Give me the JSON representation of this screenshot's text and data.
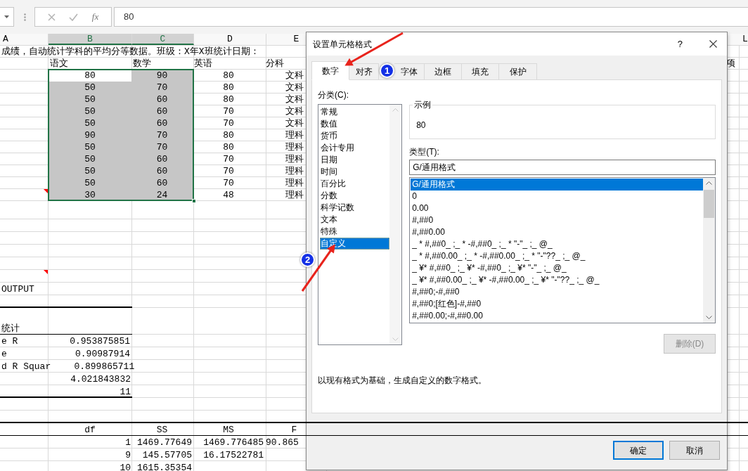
{
  "formula_bar": {
    "function_label": "fx",
    "value": "80"
  },
  "sheet": {
    "columns": [
      {
        "label": "A",
        "selected": false
      },
      {
        "label": "B",
        "selected": true
      },
      {
        "label": "C",
        "selected": true
      },
      {
        "label": "D",
        "selected": false
      },
      {
        "label": "E",
        "selected": false
      },
      {
        "label": "L",
        "selected": false
      }
    ],
    "rows": [
      {
        "cells": {
          "a": {
            "text": "成绩，自动统计学科的平均分等数据。班级：X年X班统计日期："
          }
        }
      },
      {
        "cells": {
          "b": {
            "text": "语文"
          },
          "c": {
            "text": "数学"
          },
          "d": {
            "text": "英语"
          },
          "e": {
            "text": "分科"
          },
          "k": {
            "text": "项",
            "kind": "number"
          }
        }
      },
      {
        "cells": {
          "b": {
            "text": "80",
            "kind": "center",
            "selected": true,
            "active": true
          },
          "c": {
            "text": "90",
            "kind": "center",
            "selected": true,
            "active": false
          },
          "d": {
            "text": "80",
            "kind": "center"
          },
          "e": {
            "text": "文科",
            "kind": "center"
          }
        }
      },
      {
        "cells": {
          "b": {
            "text": "50",
            "kind": "center",
            "selected": true,
            "active": false
          },
          "c": {
            "text": "70",
            "kind": "center",
            "selected": true,
            "active": false
          },
          "d": {
            "text": "80",
            "kind": "center"
          },
          "e": {
            "text": "文科",
            "kind": "center"
          }
        }
      },
      {
        "cells": {
          "b": {
            "text": "50",
            "kind": "center",
            "selected": true,
            "active": false
          },
          "c": {
            "text": "60",
            "kind": "center",
            "selected": true,
            "active": false
          },
          "d": {
            "text": "80",
            "kind": "center"
          },
          "e": {
            "text": "文科",
            "kind": "center"
          }
        }
      },
      {
        "cells": {
          "b": {
            "text": "50",
            "kind": "center",
            "selected": true,
            "active": false
          },
          "c": {
            "text": "60",
            "kind": "center",
            "selected": true,
            "active": false
          },
          "d": {
            "text": "70",
            "kind": "center"
          },
          "e": {
            "text": "文科",
            "kind": "center"
          }
        }
      },
      {
        "cells": {
          "b": {
            "text": "50",
            "kind": "center",
            "selected": true,
            "active": false
          },
          "c": {
            "text": "60",
            "kind": "center",
            "selected": true,
            "active": false
          },
          "d": {
            "text": "70",
            "kind": "center"
          },
          "e": {
            "text": "文科",
            "kind": "center"
          }
        }
      },
      {
        "cells": {
          "b": {
            "text": "90",
            "kind": "center",
            "selected": true,
            "active": false
          },
          "c": {
            "text": "70",
            "kind": "center",
            "selected": true,
            "active": false
          },
          "d": {
            "text": "80",
            "kind": "center"
          },
          "e": {
            "text": "理科",
            "kind": "center"
          }
        }
      },
      {
        "cells": {
          "b": {
            "text": "50",
            "kind": "center",
            "selected": true,
            "active": false
          },
          "c": {
            "text": "70",
            "kind": "center",
            "selected": true,
            "active": false
          },
          "d": {
            "text": "80",
            "kind": "center"
          },
          "e": {
            "text": "理科",
            "kind": "center"
          }
        }
      },
      {
        "cells": {
          "b": {
            "text": "50",
            "kind": "center",
            "selected": true,
            "active": false
          },
          "c": {
            "text": "60",
            "kind": "center",
            "selected": true,
            "active": false
          },
          "d": {
            "text": "70",
            "kind": "center"
          },
          "e": {
            "text": "理科",
            "kind": "center"
          }
        }
      },
      {
        "cells": {
          "b": {
            "text": "50",
            "kind": "center",
            "selected": true,
            "active": false
          },
          "c": {
            "text": "60",
            "kind": "center",
            "selected": true,
            "active": false
          },
          "d": {
            "text": "70",
            "kind": "center"
          },
          "e": {
            "text": "理科",
            "kind": "center"
          }
        }
      },
      {
        "cells": {
          "b": {
            "text": "50",
            "kind": "center",
            "selected": true,
            "active": false
          },
          "c": {
            "text": "60",
            "kind": "center",
            "selected": true,
            "active": false
          },
          "d": {
            "text": "70",
            "kind": "center"
          },
          "e": {
            "text": "理科",
            "kind": "center"
          }
        }
      },
      {
        "cells": {
          "a": {
            "note": true
          },
          "b": {
            "text": "30",
            "kind": "center",
            "selected": true,
            "active": false
          },
          "c": {
            "text": "24",
            "kind": "center",
            "selected": true,
            "active": false
          },
          "d": {
            "text": "48",
            "kind": "center"
          },
          "e": {
            "text": "理科",
            "kind": "center"
          }
        }
      },
      {
        "cells": {}
      },
      {
        "cells": {}
      },
      {
        "cells": {}
      },
      {
        "cells": {}
      },
      {
        "cells": {}
      },
      {
        "cells": {
          "a": {
            "note": true
          }
        }
      },
      {
        "cells": {
          "a": {
            "text": "OUTPUT"
          }
        }
      },
      {
        "cells": {},
        "underline": true,
        "heavy": true,
        "full_width": false
      },
      {
        "cells": {
          "a": {
            "text": "统计"
          }
        },
        "tall": true,
        "underline": true,
        "heavy": false,
        "full_width": false
      },
      {
        "cells": {
          "a": {
            "text": "e R"
          },
          "b": {
            "text": "0.953875851",
            "kind": "number"
          }
        }
      },
      {
        "cells": {
          "a": {
            "text": "e"
          },
          "b": {
            "text": "0.90987914",
            "kind": "number"
          }
        }
      },
      {
        "cells": {
          "a": {
            "text": "d R Squar"
          },
          "b": {
            "text": "0.899865711",
            "kind": "number"
          }
        }
      },
      {
        "cells": {
          "b": {
            "text": "4.021843832",
            "kind": "number"
          }
        }
      },
      {
        "cells": {
          "b": {
            "text": "11",
            "kind": "number"
          }
        },
        "underline": true,
        "heavy": true,
        "full_width": false
      },
      {
        "cells": {}
      },
      {
        "cells": {},
        "underline": true,
        "heavy": true,
        "full_width": true
      },
      {
        "cells": {
          "b": {
            "text": "df",
            "kind": "center"
          },
          "c": {
            "text": "SS",
            "kind": "center"
          },
          "d": {
            "text": "MS",
            "kind": "center"
          },
          "e": {
            "text": "F",
            "kind": "center"
          }
        },
        "underline": true,
        "heavy": false,
        "full_width": true
      },
      {
        "cells": {
          "b": {
            "text": "1",
            "kind": "number"
          },
          "c": {
            "text": "1469.77649",
            "kind": "number"
          },
          "d": {
            "text": "1469.776485",
            "kind": "number"
          },
          "e": {
            "text": "90.865"
          }
        }
      },
      {
        "cells": {
          "b": {
            "text": "9",
            "kind": "number"
          },
          "c": {
            "text": "145.57705",
            "kind": "number"
          },
          "d": {
            "text": "16.17522781",
            "kind": "number"
          }
        }
      },
      {
        "cells": {
          "b": {
            "text": "10",
            "kind": "number"
          },
          "c": {
            "text": "1615.35354",
            "kind": "number"
          }
        }
      }
    ]
  },
  "dialog": {
    "title": "设置单元格格式",
    "help": "?",
    "tabs": [
      {
        "label": "数字",
        "selected": true
      },
      {
        "label": "对齐",
        "selected": false
      },
      {
        "label": "字体",
        "selected": false
      },
      {
        "label": "边框",
        "selected": false
      },
      {
        "label": "填充",
        "selected": false
      },
      {
        "label": "保护",
        "selected": false
      }
    ],
    "category_label": "分类(C):",
    "categories": [
      {
        "label": "常规",
        "selected": false
      },
      {
        "label": "数值",
        "selected": false
      },
      {
        "label": "货币",
        "selected": false
      },
      {
        "label": "会计专用",
        "selected": false
      },
      {
        "label": "日期",
        "selected": false
      },
      {
        "label": "时间",
        "selected": false
      },
      {
        "label": "百分比",
        "selected": false
      },
      {
        "label": "分数",
        "selected": false
      },
      {
        "label": "科学记数",
        "selected": false
      },
      {
        "label": "文本",
        "selected": false
      },
      {
        "label": "特殊",
        "selected": false
      },
      {
        "label": "自定义",
        "selected": true
      }
    ],
    "sample": {
      "label": "示例",
      "value": "80"
    },
    "type_label": "类型(T):",
    "type_value": "G/通用格式",
    "formats": [
      {
        "label": "G/通用格式",
        "selected": true
      },
      {
        "label": "0",
        "selected": false
      },
      {
        "label": "0.00",
        "selected": false
      },
      {
        "label": "#,##0",
        "selected": false
      },
      {
        "label": "#,##0.00",
        "selected": false
      },
      {
        "label": "_ * #,##0_ ;_ * -#,##0_ ;_ * \"-\"_ ;_ @_",
        "selected": false
      },
      {
        "label": "_ * #,##0.00_ ;_ * -#,##0.00_ ;_ * \"-\"??_ ;_ @_",
        "selected": false
      },
      {
        "label": "_ ¥* #,##0_ ;_ ¥* -#,##0_ ;_ ¥* \"-\"_ ;_ @_",
        "selected": false
      },
      {
        "label": "_ ¥* #,##0.00_ ;_ ¥* -#,##0.00_ ;_ ¥* \"-\"??_ ;_ @_",
        "selected": false
      },
      {
        "label": "#,##0;-#,##0",
        "selected": false
      },
      {
        "label": "#,##0;[红色]-#,##0",
        "selected": false
      },
      {
        "label": "#,##0.00;-#,##0.00",
        "selected": false
      }
    ],
    "delete_button": {
      "label": "删除(D)",
      "disabled": true
    },
    "description": "以现有格式为基础，生成自定义的数字格式。",
    "buttons": [
      {
        "label": "确定",
        "default": true
      },
      {
        "label": "取消",
        "default": false
      }
    ]
  },
  "callouts": [
    {
      "label": "1"
    },
    {
      "label": "2"
    }
  ]
}
